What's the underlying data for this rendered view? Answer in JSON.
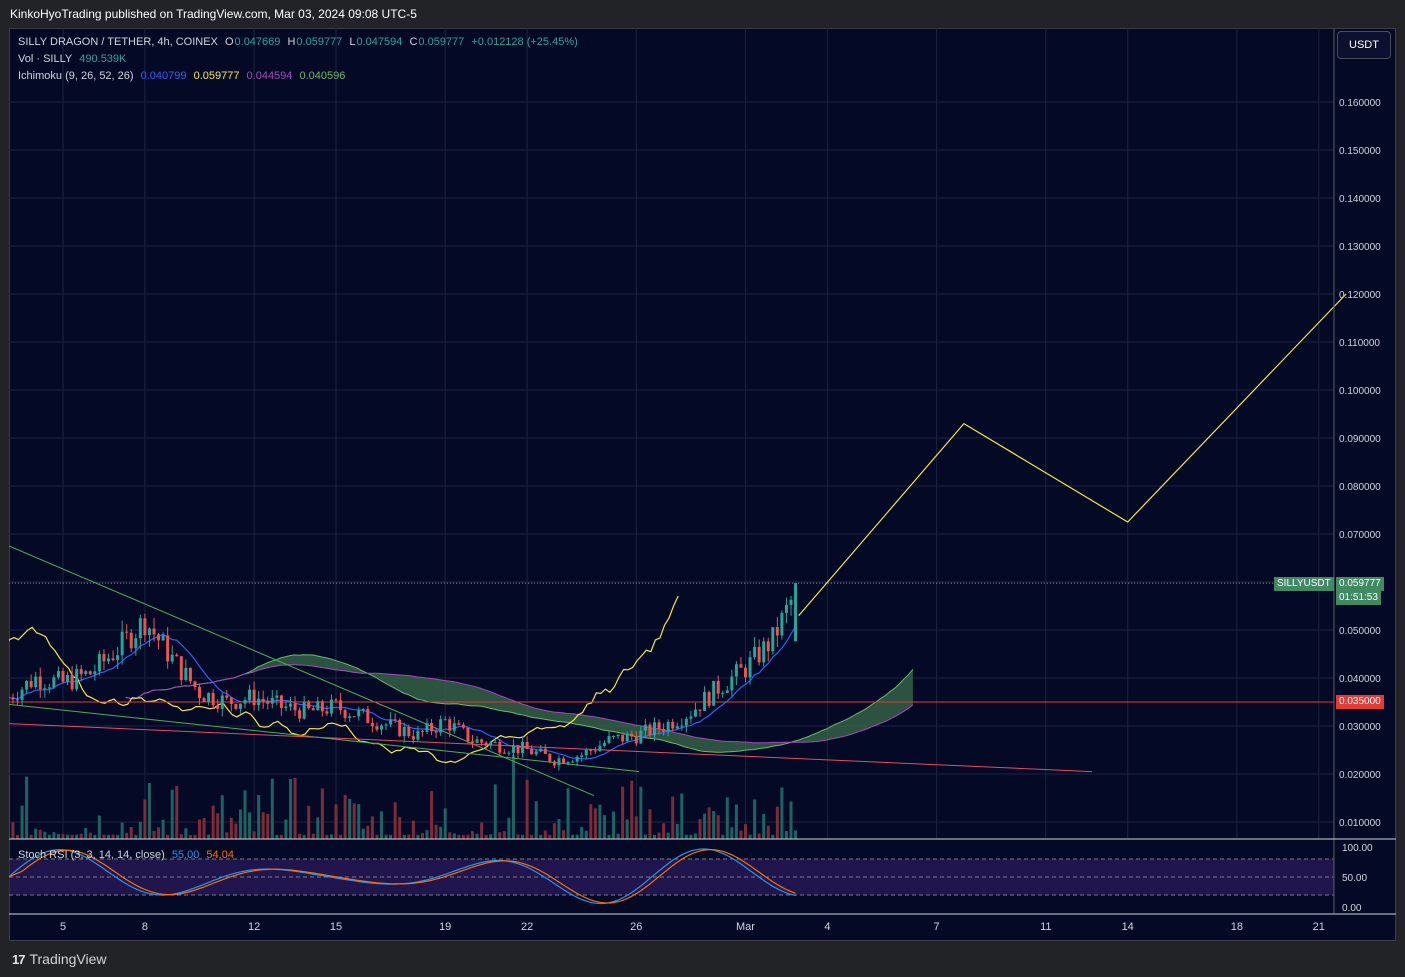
{
  "header": {
    "publisher": "KinkoHyoTrading published on TradingView.com, Mar 03, 2024 09:08 UTC-5"
  },
  "legend": {
    "symbol": "SILLY DRAGON / TETHER, 4h, COINEX",
    "o_label": "O",
    "o": "0.047669",
    "h_label": "H",
    "h": "0.059777",
    "l_label": "L",
    "l": "0.047594",
    "c_label": "C",
    "c": "0.059777",
    "change": "+0.012128 (+25.45%)",
    "vol_label": "Vol · SILLY",
    "vol": "490.539K",
    "ichimoku_label": "Ichimoku (9, 26, 52, 26)",
    "ich1": "0.040799",
    "ich2": "0.059777",
    "ich3": "0.044594",
    "ich4": "0.040596",
    "stoch_label": "Stoch RSI (3, 3, 14, 14, close)",
    "stoch_k": "55.00",
    "stoch_d": "54.04"
  },
  "currency_button": "USDT",
  "price_tags": {
    "symbol_tag": "SILLYUSDT",
    "last_price": "0.059777",
    "countdown": "01:51:53",
    "level": "0.035000"
  },
  "colors": {
    "background": "#040a26",
    "up": "#26a69a",
    "down": "#ef5350",
    "tenkan": "#2962ff",
    "kijun": "#f5e642",
    "span_b": "#ab47bc",
    "lagging": "#66bb6a",
    "cloud_bull": "#3a6b4a",
    "cloud_bear": "#6b1d5a",
    "projection": "#f5e642",
    "trend_green": "#4caf50",
    "trend_red": "#e84a5f",
    "level_line": "#e53935",
    "stoch_k": "#2196f3",
    "stoch_d": "#ff6d00"
  },
  "footer": {
    "brand": "TradingView"
  },
  "chart_data": {
    "type": "candlestick",
    "price_axis": {
      "ticks": [
        "0.160000",
        "0.150000",
        "0.140000",
        "0.130000",
        "0.120000",
        "0.110000",
        "0.100000",
        "0.090000",
        "0.080000",
        "0.070000",
        "0.050000",
        "0.040000",
        "0.030000",
        "0.020000",
        "0.010000"
      ],
      "range": [
        0.0055,
        0.172
      ]
    },
    "time_axis": {
      "ticks": [
        "5",
        "8",
        "12",
        "15",
        "19",
        "22",
        "26",
        "Mar",
        "4",
        "7",
        "11",
        "14",
        "18",
        "21"
      ]
    },
    "stoch_axis": {
      "ticks": [
        "100.00",
        "50.00",
        "0.00"
      ],
      "range": [
        0,
        100
      ]
    },
    "price_series_approx": [
      [
        "Feb 03",
        0.036
      ],
      [
        "Feb 04",
        0.04
      ],
      [
        "Feb 05",
        0.039
      ],
      [
        "Feb 06",
        0.041
      ],
      [
        "Feb 07",
        0.046
      ],
      [
        "Feb 08",
        0.052
      ],
      [
        "Feb 09",
        0.044
      ],
      [
        "Feb 10",
        0.037
      ],
      [
        "Feb 11",
        0.035
      ],
      [
        "Feb 12",
        0.036
      ],
      [
        "Feb 13",
        0.034
      ],
      [
        "Feb 14",
        0.033
      ],
      [
        "Feb 15",
        0.034
      ],
      [
        "Feb 16",
        0.032
      ],
      [
        "Feb 17",
        0.03
      ],
      [
        "Feb 18",
        0.028
      ],
      [
        "Feb 19",
        0.031
      ],
      [
        "Feb 20",
        0.027
      ],
      [
        "Feb 21",
        0.026
      ],
      [
        "Feb 22",
        0.025
      ],
      [
        "Feb 23",
        0.023
      ],
      [
        "Feb 24",
        0.024
      ],
      [
        "Feb 25",
        0.027
      ],
      [
        "Feb 26",
        0.028
      ],
      [
        "Feb 27",
        0.03
      ],
      [
        "Feb 28",
        0.033
      ],
      [
        "Feb 29",
        0.038
      ],
      [
        "Mar 01",
        0.042
      ],
      [
        "Mar 02",
        0.048
      ],
      [
        "Mar 03",
        0.0598
      ]
    ],
    "projection_path": [
      [
        "Mar 03",
        0.053
      ],
      [
        "Mar 09",
        0.093
      ],
      [
        "Mar 15",
        0.0725
      ],
      [
        "Mar 23",
        0.12
      ]
    ],
    "horizontal_level": 0.035
  }
}
